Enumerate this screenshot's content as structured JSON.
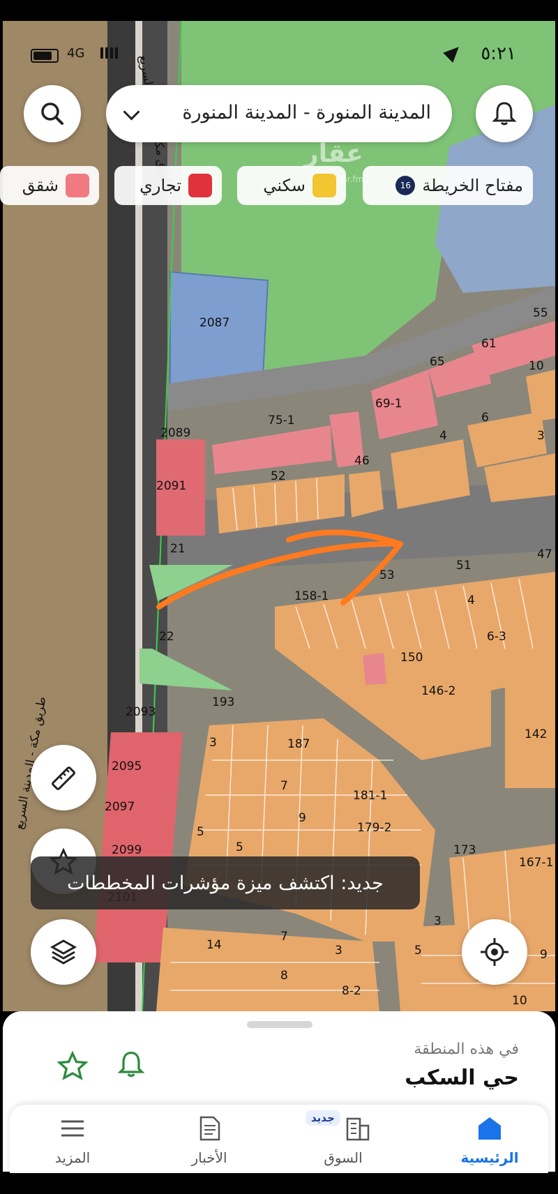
{
  "status": {
    "time": "٥:٢١",
    "network": "4G"
  },
  "header": {
    "location_label": "المدينة المنورة - المدينة المنورة"
  },
  "legend": {
    "key_label": "مفتاح الخريطة",
    "key_badge": "16",
    "items": [
      {
        "label": "سكني",
        "color": "#f2c531"
      },
      {
        "label": "تجاري",
        "color": "#e0323a"
      },
      {
        "label": "شقق",
        "color": "#f07a80"
      }
    ]
  },
  "watermark": {
    "text": "عقار",
    "sub": "sa.aqar.fm"
  },
  "map": {
    "road_labels": [
      "طريق مكة - المدينة السريع",
      "طريق مكة - المدينة السريع"
    ],
    "plot_labels": [
      "2087",
      "2089",
      "2091",
      "75-1",
      "52",
      "46",
      "69-1",
      "65",
      "61",
      "55",
      "10",
      "6",
      "4",
      "3",
      "21",
      "22",
      "158-1",
      "53",
      "51",
      "47",
      "4",
      "6-3",
      "150",
      "146-2",
      "142",
      "2093",
      "193",
      "3",
      "187",
      "2095",
      "7",
      "181-1",
      "2097",
      "9",
      "179-2",
      "5",
      "5",
      "2099",
      "173",
      "167-1",
      "2101",
      "14",
      "7",
      "3",
      "8",
      "8-2",
      "3",
      "5",
      "7",
      "9",
      "10"
    ]
  },
  "toast": {
    "text": "جديد: اكتشف ميزة مؤشرات المخططات"
  },
  "sheet": {
    "subtitle": "في هذه المنطقة",
    "title": "حي السكب"
  },
  "nav": {
    "home": "الرئيسية",
    "market": "السوق",
    "market_badge": "جديد",
    "news": "الأخبار",
    "more": "المزيد"
  },
  "colors": {
    "residential": "#f2c531",
    "commercial": "#e0323a",
    "apartments": "#f07a80",
    "accent": "#1a73e8",
    "arrow": "#ff7a1f"
  }
}
